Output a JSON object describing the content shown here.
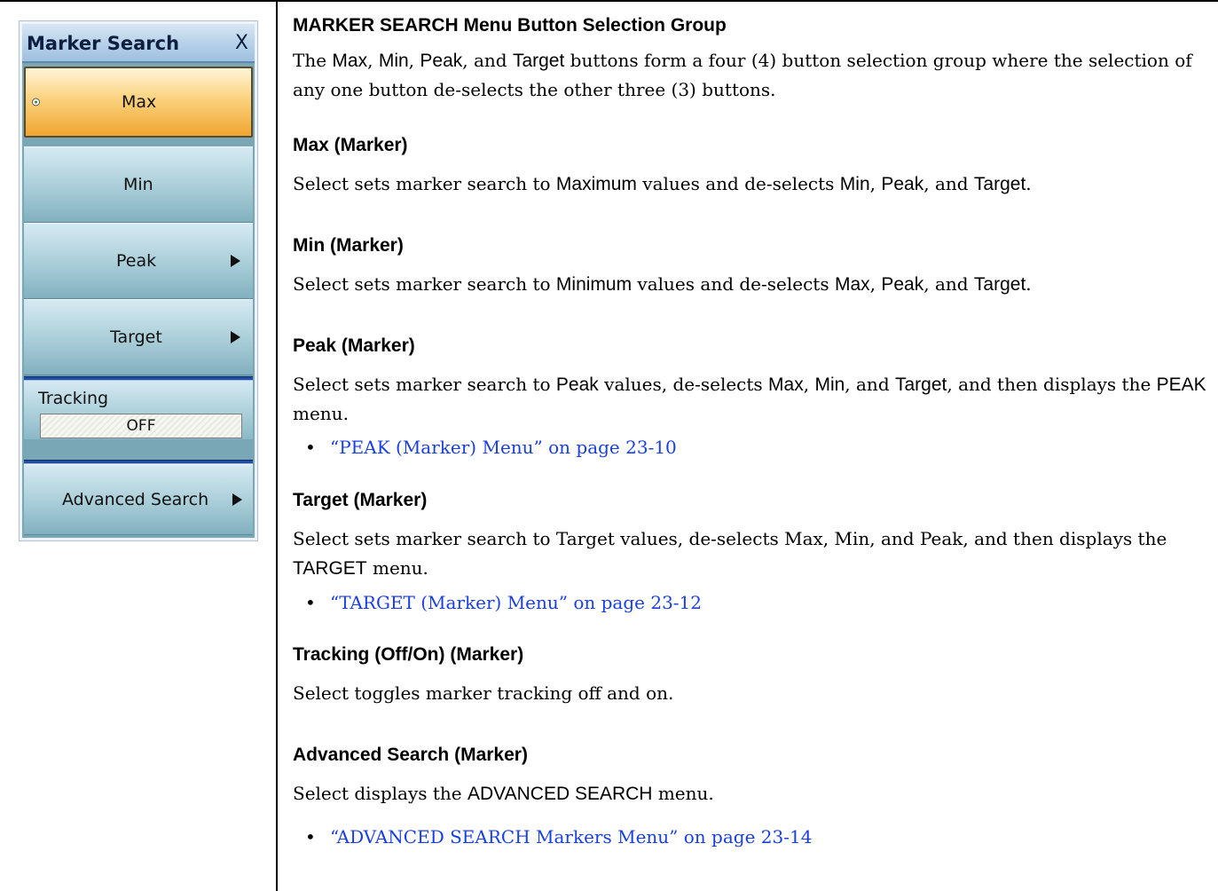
{
  "menu": {
    "title": "Marker Search",
    "close_label": "X",
    "buttons": [
      {
        "label": "Max",
        "selected": true
      },
      {
        "label": "Min"
      },
      {
        "label": "Peak"
      },
      {
        "label": "Target"
      }
    ],
    "tracking": {
      "label": "Tracking",
      "value": "OFF"
    },
    "advanced_search_label": "Advanced Search"
  },
  "doc": {
    "group_heading": "MARKER SEARCH Menu Button Selection Group",
    "group_para": {
      "t1": "The ",
      "b1": "Max",
      "t2": ", ",
      "b2": "Min",
      "t3": ", ",
      "b3": "Peak",
      "t4": ", and ",
      "b4": "Target",
      "t5": " buttons form a four (4) button selection group where the selection of any one button de-selects the other three (3) buttons."
    },
    "max": {
      "heading": "Max (Marker)",
      "t1": "Select sets marker search to ",
      "b1": "Maximum",
      "t2": " values and de-selects ",
      "b2": "Min",
      "t3": ", ",
      "b3": "Peak",
      "t4": ", and ",
      "b4": "Target",
      "t5": "."
    },
    "min": {
      "heading": "Min (Marker)",
      "t1": "Select sets marker search to ",
      "b1": "Minimum",
      "t2": " values and de-selects ",
      "b2": "Max",
      "t3": ", ",
      "b3": "Peak",
      "t4": ", and ",
      "b4": "Target",
      "t5": "."
    },
    "peak": {
      "heading": "Peak (Marker)",
      "t1": "Select sets marker search to ",
      "b1": "Peak",
      "t2": " values, de-selects ",
      "b2": "Max",
      "t3": ", ",
      "b3": "Min",
      "t4": ", and ",
      "b4": "Target",
      "t5": ", and then displays the ",
      "b5": "PEAK",
      "t6": " menu.",
      "link": "“PEAK (Marker) Menu” on page 23-10"
    },
    "target": {
      "heading": "Target (Marker)",
      "t1": "Select sets marker search to Target values, de-selects Max, Min, and Peak, and then displays the ",
      "b1": "TARGET",
      "t2": " menu.",
      "link": "“TARGET (Marker) Menu” on page 23-12"
    },
    "tracking": {
      "heading": "Tracking (Off/On) (Marker)",
      "text": "Select toggles marker tracking off and on."
    },
    "advanced": {
      "heading": "Advanced Search (Marker)",
      "t1": "Select displays the ",
      "b1": "ADVANCED SEARCH",
      "t2": " menu.",
      "link": "“ADVANCED SEARCH Markers Menu” on page 23-14"
    },
    "bullet_char": "•"
  }
}
